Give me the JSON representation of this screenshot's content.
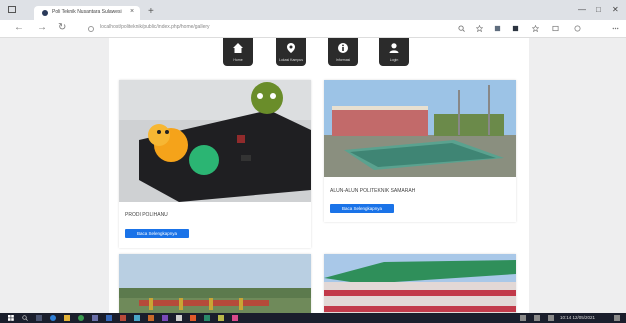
{
  "browser": {
    "tab_title": "Poli Teknik Nusantara Sulawesi",
    "url": "localhost/politeknik/public/index.php/home/gallery",
    "close_glyph": "×",
    "new_tab_glyph": "+"
  },
  "nav": {
    "items": [
      {
        "label": "Home",
        "icon": "home-icon"
      },
      {
        "label": "Lokasi Kampus",
        "icon": "map-marker-icon"
      },
      {
        "label": "Informasi",
        "icon": "info-icon"
      },
      {
        "label": "Login",
        "icon": "user-icon"
      }
    ]
  },
  "cards": [
    {
      "title": "PRODI POLIHANU",
      "button": "Baca Selengkapnya"
    },
    {
      "title": "ALUN-ALUN POLITEKNIK SAMARAH",
      "button": "Baca Selengkapnya"
    },
    {
      "title": "",
      "button": ""
    },
    {
      "title": "",
      "button": ""
    }
  ],
  "taskbar": {
    "time": "10:14  12/05/2021"
  },
  "colors": {
    "button_blue": "#1a73e8",
    "nav_dark": "#2b2b2b",
    "taskbar": "#1a1e2c"
  }
}
